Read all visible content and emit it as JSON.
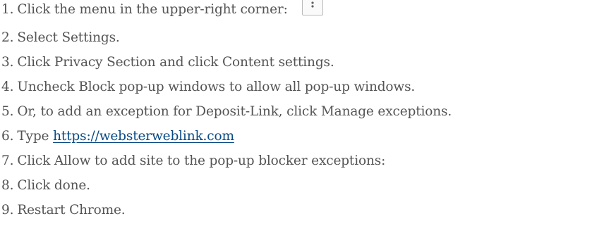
{
  "steps": [
    {
      "num": "1.",
      "text": "Click the menu in the upper-right corner:"
    },
    {
      "num": "2.",
      "text": "Select Settings."
    },
    {
      "num": "3.",
      "text": "Click Privacy Section and click Content settings."
    },
    {
      "num": "4.",
      "text": "Uncheck Block pop-up windows to allow all pop-up windows."
    },
    {
      "num": "5.",
      "text": "Or, to add an exception for Deposit-Link, click Manage exceptions."
    },
    {
      "num": "6.",
      "text": "Type",
      "link": "https://websterweblink.com"
    },
    {
      "num": "7.",
      "text": "Click Allow to add site to the pop-up blocker exceptions:"
    },
    {
      "num": "8.",
      "text": "Click done."
    },
    {
      "num": "9.",
      "text": "Restart Chrome."
    }
  ],
  "icons": {
    "menu_button": "vertical-dots-menu-icon"
  },
  "colors": {
    "text": "#545454",
    "link": "#0a4a85"
  }
}
